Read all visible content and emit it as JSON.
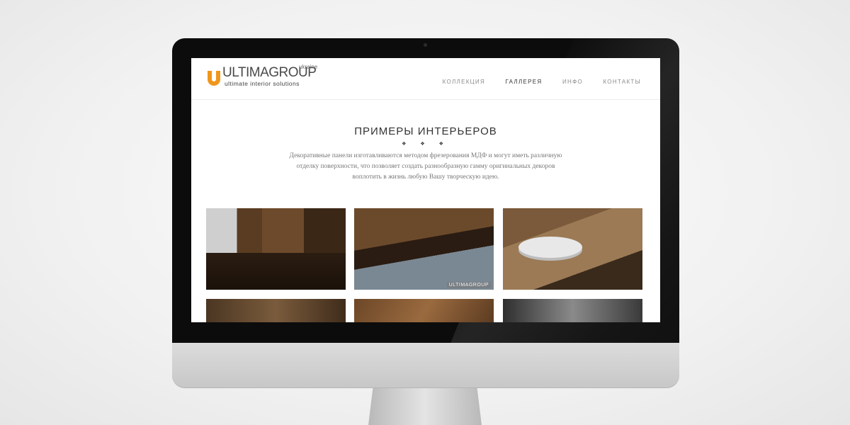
{
  "brand": {
    "name": "ULTIMAGROUP",
    "region": "ukraine",
    "tagline": "ultimate interior solutions",
    "accent": "#f0961c"
  },
  "nav": {
    "items": [
      "КОЛЛЕКЦИЯ",
      "ГАЛЛЕРЕЯ",
      "ИНФО",
      "КОНТАКТЫ"
    ],
    "active": "ГАЛЛЕРЕЯ"
  },
  "section": {
    "title": "ПРИМЕРЫ ИНТЕРЬЕРОВ",
    "ornament": "❖ ❖ ❖",
    "description_lines": [
      "Декоративные панели изготавливаются методом фрезерования МДФ и могут иметь различную",
      "отделку поверхности, что позволяет создать разнообразную гамму оригинальных декоров",
      "воплотить в жизнь любую Вашу творческую идею."
    ]
  },
  "gallery": {
    "watermark": "ULTIMAGROUP"
  }
}
